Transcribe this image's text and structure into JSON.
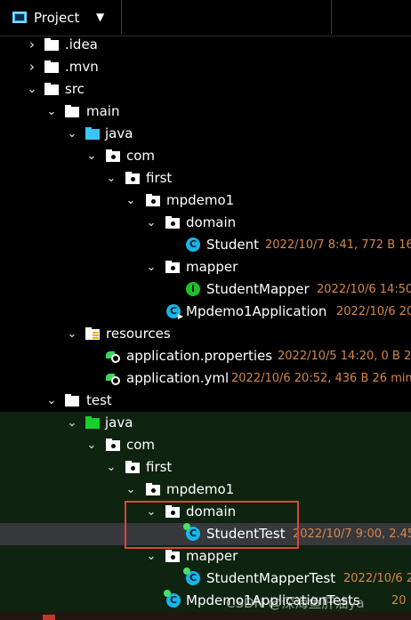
{
  "header": {
    "title": "Project",
    "dropdown_icon": "caret-down-icon"
  },
  "tree": [
    {
      "label": "Project",
      "hidden": true
    }
  ],
  "rows": {
    "idea": {
      "label": ".idea"
    },
    "mvn": {
      "label": ".mvn"
    },
    "src": {
      "label": "src"
    },
    "main": {
      "label": "main"
    },
    "main_java": {
      "label": "java"
    },
    "main_com": {
      "label": "com"
    },
    "main_first": {
      "label": "first"
    },
    "main_pkg": {
      "label": "mpdemo1"
    },
    "main_domain": {
      "label": "domain"
    },
    "student": {
      "label": "Student",
      "meta": "2022/10/7 8:41, 772 B 16"
    },
    "main_mapper": {
      "label": "mapper"
    },
    "student_mapper": {
      "label": "StudentMapper",
      "meta": "2022/10/6 14:50"
    },
    "app": {
      "label": "Mpdemo1Application",
      "meta": "2022/10/6 20"
    },
    "resources": {
      "label": "resources"
    },
    "app_props": {
      "label": "application.properties",
      "meta": "2022/10/5 14:20, 0 B 20"
    },
    "app_yml": {
      "label": "application.yml",
      "meta": "2022/10/6 20:52, 436 B 26 minu"
    },
    "test": {
      "label": "test"
    },
    "test_java": {
      "label": "java"
    },
    "test_com": {
      "label": "com"
    },
    "test_first": {
      "label": "first"
    },
    "test_pkg": {
      "label": "mpdemo1"
    },
    "test_domain": {
      "label": "domain"
    },
    "student_test": {
      "label": "StudentTest",
      "meta": "2022/10/7 9:00, 2.45"
    },
    "test_mapper": {
      "label": "mapper"
    },
    "student_mapper_test": {
      "label": "StudentMapperTest",
      "meta": "2022/10/6 2"
    },
    "app_tests": {
      "label": "Mpdemo1ApplicationTests",
      "meta": "20"
    }
  },
  "watermark": "CSDN @深海鱼肝油ya",
  "colors": {
    "background": "#000000",
    "test_background": "#0f2410",
    "selected_row": "#37393d",
    "meta_text": "#d6874a",
    "highlight_border": "#e0443a",
    "source_folder": "#38c6ff",
    "test_folder": "#18d12a",
    "class_icon": "#1ab5e8",
    "interface_icon": "#1fbf2c"
  }
}
